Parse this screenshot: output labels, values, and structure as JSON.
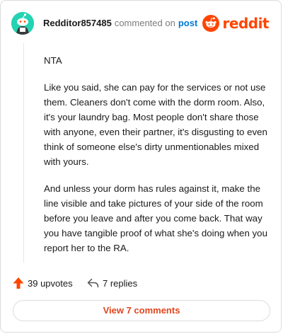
{
  "header": {
    "username": "Redditor857485",
    "verb": "commented on",
    "post_link": "post",
    "brand": "reddit"
  },
  "comment": {
    "paragraphs": [
      "NTA",
      "Like you said, she can pay for the services or not use them. Cleaners don't come with the dorm room. Also, it's your laundry bag. Most people don't share those with anyone, even their partner, it's disgusting to even think of someone else's dirty unmentionables mixed with yours.",
      "And unless your dorm has rules against it, make the line visible and take pictures of your side of the room before you leave and after you come back. That way you have tangible proof of what she's doing when you report her to the RA."
    ]
  },
  "actions": {
    "upvotes": "39 upvotes",
    "replies": "7 replies"
  },
  "footer": {
    "view_comments": "View 7 comments"
  },
  "colors": {
    "brand": "#ff4500",
    "avatar_bg": "#24d3b2",
    "post_link": "#0079d3",
    "view_button": "#e0461e"
  },
  "icons": {
    "avatar": "snoo-avatar-icon",
    "logo": "reddit-alien-icon",
    "upvote": "upvote-arrow-icon",
    "reply": "reply-arrow-icon"
  }
}
